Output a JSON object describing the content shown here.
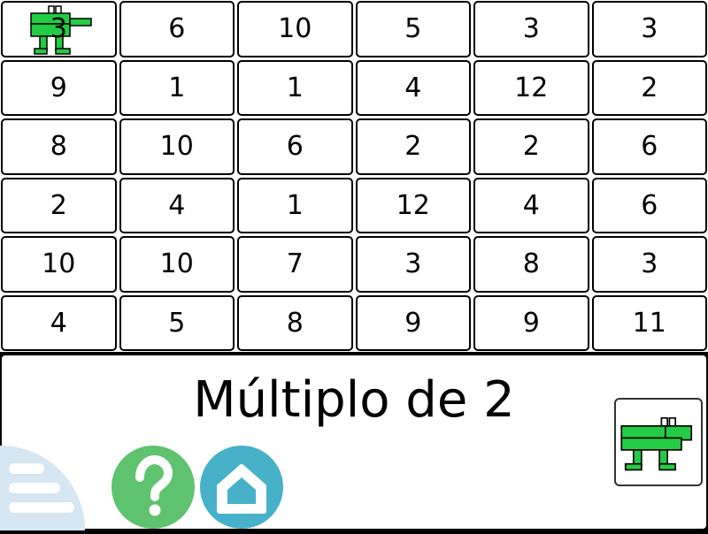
{
  "game": {
    "rule": "Múltiplo de 2",
    "grid": [
      [
        "3",
        "6",
        "10",
        "5",
        "3",
        "3"
      ],
      [
        "9",
        "1",
        "1",
        "4",
        "12",
        "2"
      ],
      [
        "8",
        "10",
        "6",
        "2",
        "2",
        "6"
      ],
      [
        "2",
        "4",
        "1",
        "12",
        "4",
        "6"
      ],
      [
        "10",
        "10",
        "7",
        "3",
        "8",
        "3"
      ],
      [
        "4",
        "5",
        "8",
        "9",
        "9",
        "11"
      ]
    ],
    "player_cell": [
      0,
      0
    ]
  },
  "colors": {
    "monster": "#22cc44",
    "help_button": "#5fc26e",
    "home_button": "#47b1c9",
    "menu_button": "#d6e6f2"
  },
  "icons": {
    "help": "question-mark-icon",
    "home": "home-icon",
    "menu": "menu-lines-icon",
    "monster": "green-monster-icon"
  }
}
